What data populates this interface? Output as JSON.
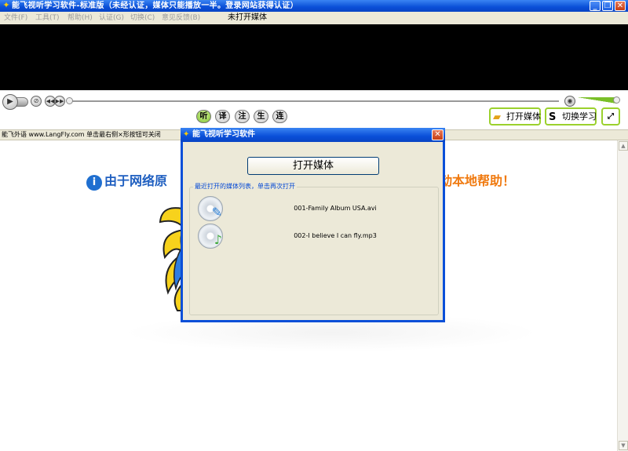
{
  "window": {
    "title": "能飞视听学习软件-标准版（未经认证，媒体只能播放一半。登录网站获得认证）",
    "minimize": "_",
    "restore": "❐",
    "close": "✕"
  },
  "menu": {
    "items": [
      "文件(F)",
      "工具(T)",
      "帮助(H)",
      "认证(G)",
      "切换(C)",
      "意见反馈(B)"
    ],
    "status": "未打开媒体"
  },
  "controls": {
    "modes": [
      "听",
      "译",
      "注",
      "生",
      "连"
    ],
    "active_mode": 0,
    "open_media_label": "打开媒体",
    "switch_learning_label": "切换学习"
  },
  "infobar": {
    "text": "能飞外语 www.LangFly.com 单击最右侧×形按钮可关闭"
  },
  "content": {
    "notice_left": "由于网络原",
    "notice_right": "动本地帮助！",
    "accent_blue": "#1f5fc0",
    "accent_orange": "#f07a10"
  },
  "dialog": {
    "title": "能飞视听学习软件",
    "close": "✕",
    "open_button": "打开媒体",
    "recent_legend": "最近打开的媒体列表，单击再次打开",
    "recent": [
      {
        "name": "001-Family Album USA.avi",
        "icon": "video-file-icon"
      },
      {
        "name": "002-I believe I can fly.mp3",
        "icon": "audio-file-icon"
      }
    ]
  }
}
